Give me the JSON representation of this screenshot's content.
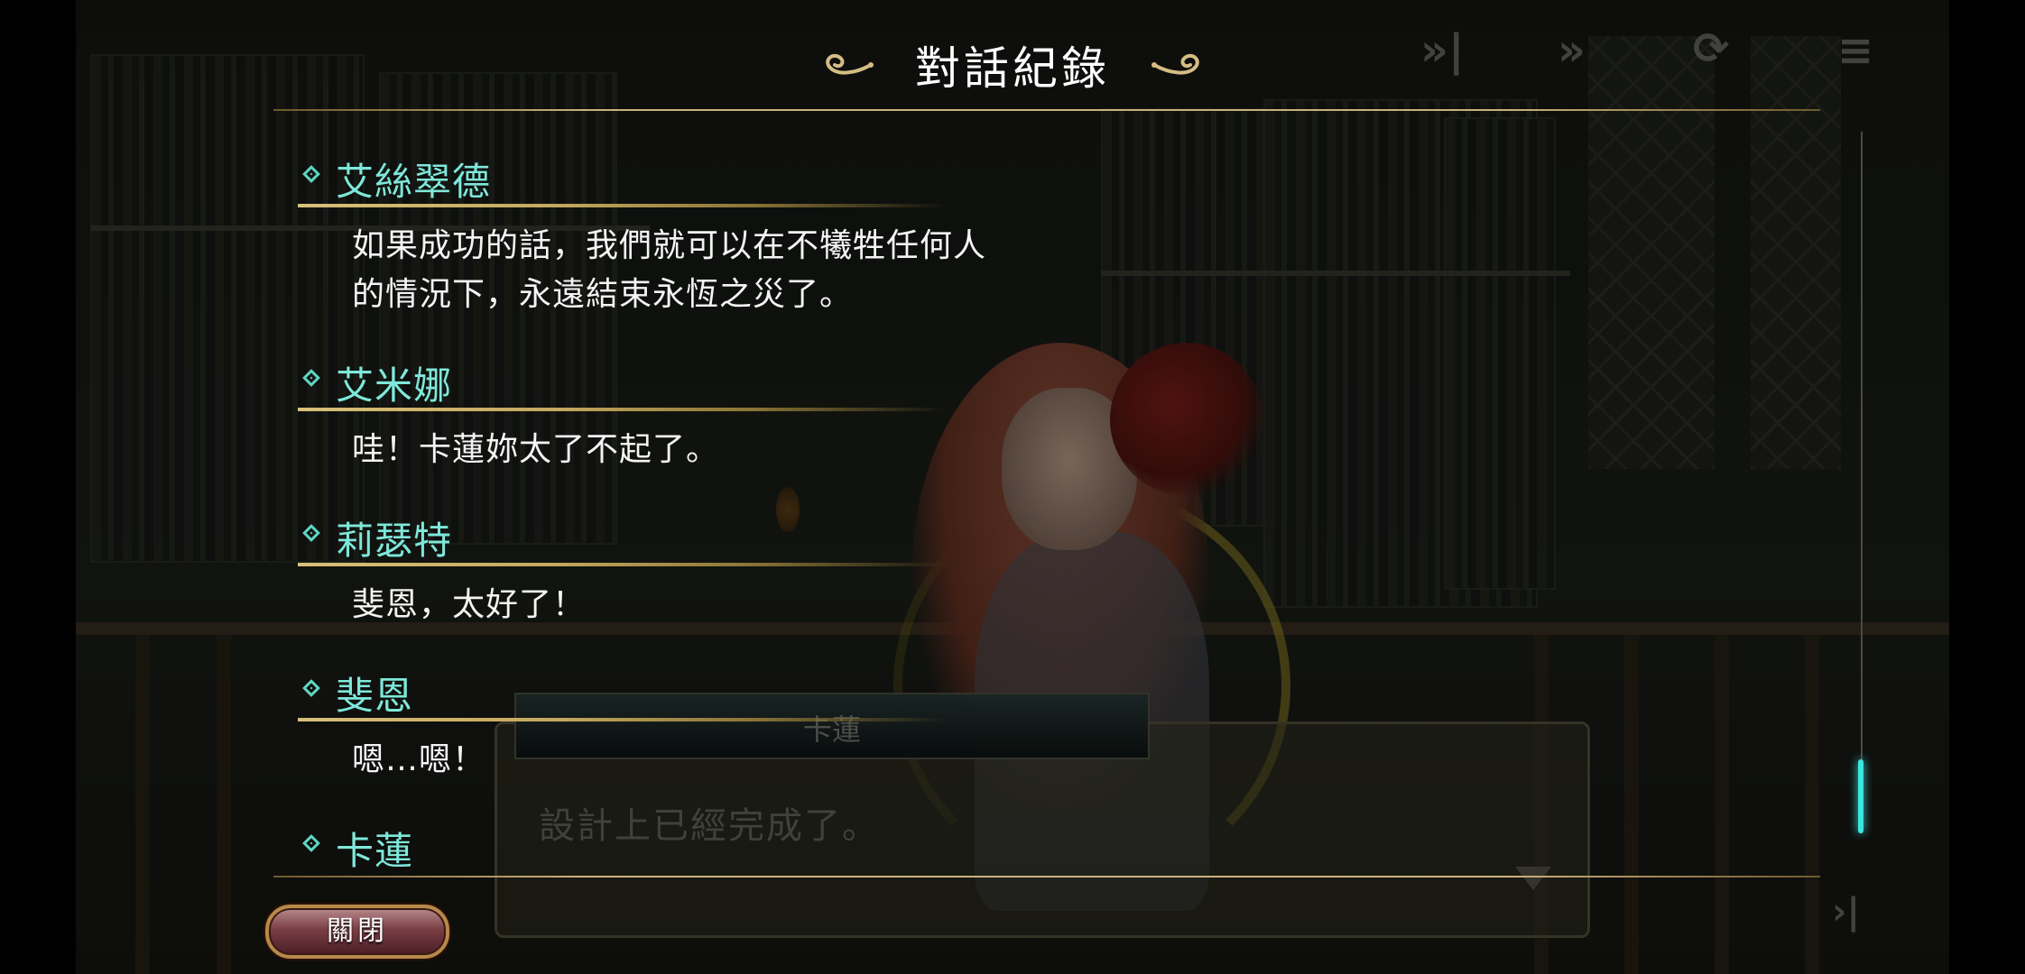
{
  "log_title": "對話紀錄",
  "entries": [
    {
      "speaker": "艾絲翠德",
      "lines": [
        "如果成功的話，我們就可以在不犧牲任何人",
        "的情況下，永遠結束永恆之災了。"
      ]
    },
    {
      "speaker": "艾米娜",
      "lines": [
        "哇！卡蓮妳太了不起了。"
      ]
    },
    {
      "speaker": "莉瑟特",
      "lines": [
        "斐恩，太好了！"
      ]
    },
    {
      "speaker": "斐恩",
      "lines": [
        "嗯…嗯！"
      ]
    },
    {
      "speaker": "卡蓮",
      "lines": []
    }
  ],
  "close_label": "關閉",
  "background_dialog": {
    "speaker": "卡蓮",
    "text": "設計上已經完成了。"
  },
  "scroll_position": 0.96,
  "colors": {
    "speaker_name": "#7ee8da",
    "gold_rule": "#c9b27a",
    "scroll_thumb": "#3ee4de"
  }
}
